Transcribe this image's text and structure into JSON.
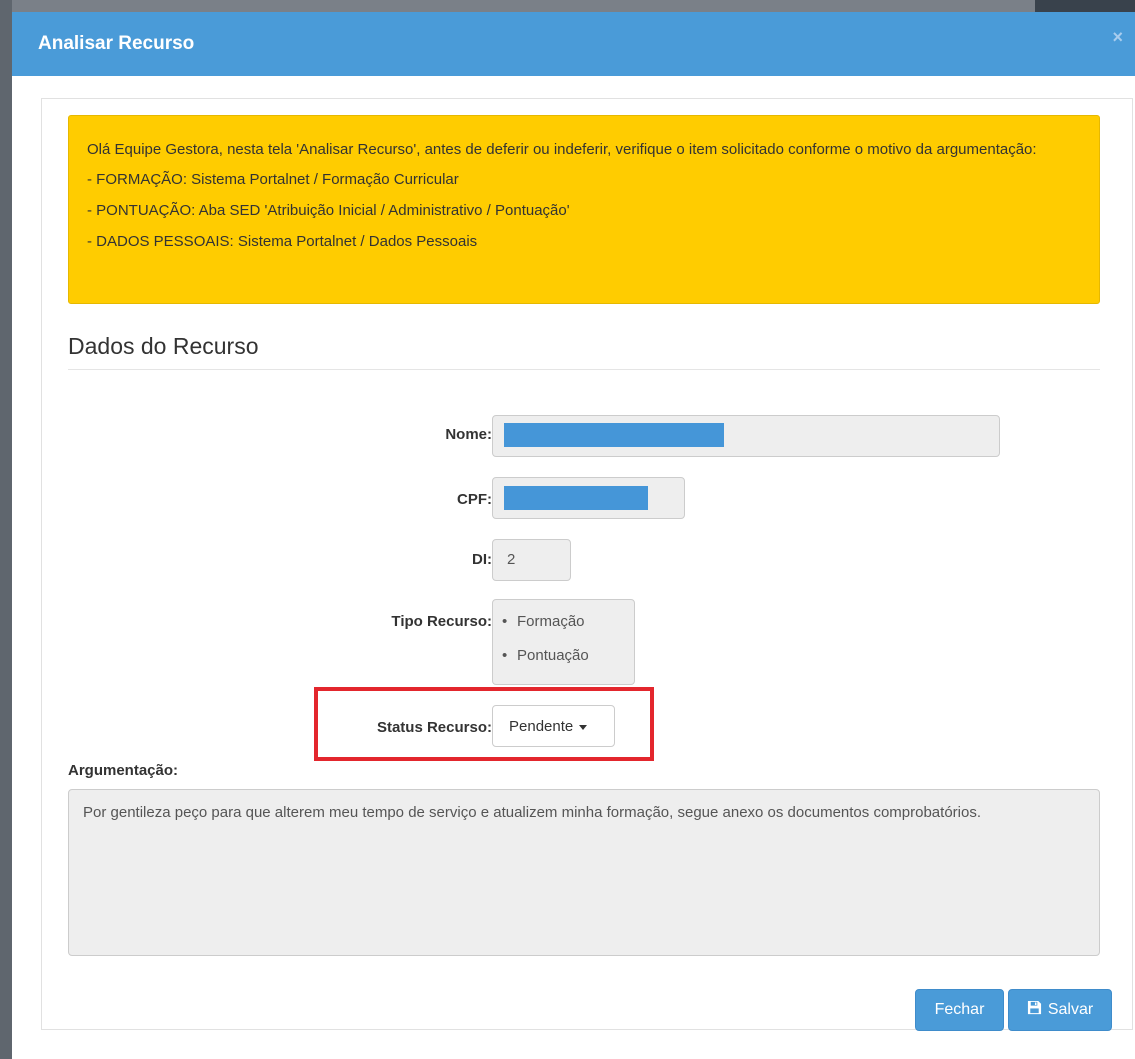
{
  "modal": {
    "title": "Analisar Recurso",
    "close": "×"
  },
  "alert": {
    "intro": "Olá Equipe Gestora, nesta tela 'Analisar Recurso', antes de deferir ou indeferir, verifique o item solicitado conforme o motivo da argumentação:",
    "items": [
      "- FORMAÇÃO: Sistema Portalnet / Formação Curricular",
      "- PONTUAÇÃO: Aba SED 'Atribuição Inicial / Administrativo / Pontuação'",
      "- DADOS PESSOAIS: Sistema Portalnet / Dados Pessoais"
    ]
  },
  "section": {
    "title": "Dados do Recurso"
  },
  "form": {
    "nome_label": "Nome:",
    "cpf_label": "CPF:",
    "di_label": "DI:",
    "di_value": "2",
    "tipo_label": "Tipo Recurso:",
    "tipo_items": [
      "Formação",
      "Pontuação"
    ],
    "status_label": "Status Recurso:",
    "status_value": "Pendente"
  },
  "argumentacao": {
    "label": "Argumentação:",
    "text": "Por gentileza peço para que alterem meu tempo de serviço e atualizem minha formação, segue anexo os documentos comprobatórios."
  },
  "footer": {
    "close_label": "Fechar",
    "save_label": "Salvar"
  },
  "colors": {
    "header": "#4a9bd8",
    "alert": "#ffcc00",
    "highlight": "#e3262d",
    "redaction": "#4596d8"
  }
}
